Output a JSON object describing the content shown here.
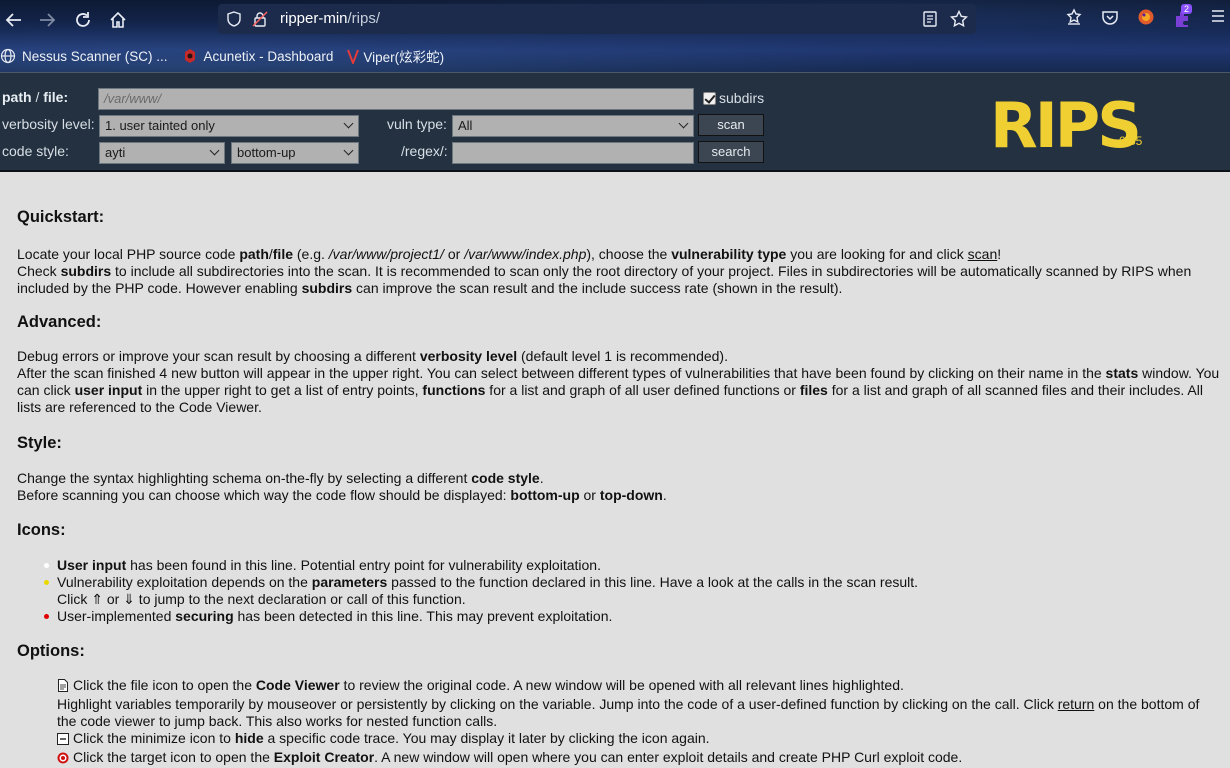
{
  "browser": {
    "url_host": "ripper-min",
    "url_path": "/rips/",
    "extension_badge": "2",
    "bookmarks": [
      {
        "label": "Nessus Scanner (SC) ...",
        "icon": "globe-icon"
      },
      {
        "label": "Acunetix - Dashboard",
        "icon": "acunetix-icon"
      },
      {
        "label": "Viper(炫彩蛇)",
        "icon": "viper-icon"
      }
    ]
  },
  "form": {
    "path_label": "path",
    "path_sep": " / ",
    "file_label": "file:",
    "path_placeholder": "/var/www/",
    "subdirs_label": "subdirs",
    "subdirs_checked": true,
    "verbosity_label": "verbosity level:",
    "verbosity_value": "1. user tainted only",
    "vuln_label": "vuln type:",
    "vuln_value": "All",
    "scan_button": "scan",
    "codestyle_label": "code style:",
    "codestyle_value": "ayti",
    "flow_value": "bottom-up",
    "regex_label": "/regex/:",
    "regex_value": "",
    "search_button": "search"
  },
  "logo": {
    "text": "RIPS",
    "version": "0.55",
    "color": "#f0cf32"
  },
  "content": {
    "quickstart": {
      "title": "Quickstart:",
      "l1_a": "Locate your local PHP source code ",
      "l1_b": "path",
      "l1_c": "/",
      "l1_d": "file",
      "l1_e": " (e.g. ",
      "l1_f": "/var/www/project1/",
      "l1_g": " or ",
      "l1_h": "/var/www/index.php",
      "l1_i": "), choose the ",
      "l1_j": "vulnerability type",
      "l1_k": " you are looking for and click ",
      "l1_link": "scan",
      "l1_l": "!",
      "l2_a": "Check ",
      "l2_b": "subdirs",
      "l2_c": " to include all subdirectories into the scan. It is recommended to scan only the root directory of your project. Files in subdirectories will be automatically scanned by RIPS when included by the PHP code. However enabling ",
      "l2_d": "subdirs",
      "l2_e": " can improve the scan result and the include success rate (shown in the result)."
    },
    "advanced": {
      "title": "Advanced:",
      "l1_a": "Debug errors or improve your scan result by choosing a different ",
      "l1_b": "verbosity level",
      "l1_c": " (default level 1 is recommended).",
      "l2_a": "After the scan finished 4 new button will appear in the upper right. You can select between different types of vulnerabilities that have been found by clicking on their name in the ",
      "l2_b": "stats",
      "l2_c": " window. You can click ",
      "l2_d": "user input",
      "l2_e": " in the upper right to get a list of entry points, ",
      "l2_f": "functions",
      "l2_g": " for a list and graph of all user defined functions or ",
      "l2_h": "files",
      "l2_i": " for a list and graph of all scanned files and their includes. All lists are referenced to the Code Viewer."
    },
    "style": {
      "title": "Style:",
      "l1_a": "Change the syntax highlighting schema on-the-fly by selecting a different ",
      "l1_b": "code style",
      "l1_c": ".",
      "l2_a": "Before scanning you can choose which way the code flow should be displayed: ",
      "l2_b": "bottom-up",
      "l2_c": " or ",
      "l2_d": "top-down",
      "l2_e": "."
    },
    "icons": {
      "title": "Icons:",
      "i1_a": "User input",
      "i1_b": " has been found in this line. Potential entry point for vulnerability exploitation.",
      "i2_a": "Vulnerability exploitation depends on the ",
      "i2_b": "parameters",
      "i2_c": " passed to the function declared in this line. Have a look at the calls in the scan result.",
      "i2_d": "Click ⇑ or ⇓ to jump to the next declaration or call of this function.",
      "i3_a": "User-implemented ",
      "i3_b": "securing",
      "i3_c": " has been detected in this line. This may prevent exploitation.",
      "dot_colors": [
        "#ffffff",
        "#e8d800",
        "#e00000"
      ]
    },
    "options": {
      "title": "Options:",
      "o1_a": "Click the file icon to open the ",
      "o1_b": "Code Viewer",
      "o1_c": " to review the original code. A new window will be opened with all relevant lines highlighted.",
      "o1_d": "Highlight variables temporarily by mouseover or persistently by clicking on the variable. Jump into the code of a user-defined function by clicking on the call. Click ",
      "o1_link": "return",
      "o1_e": " on the bottom of the code viewer to jump back. This also works for nested function calls.",
      "o2_a": "Click the minimize icon to ",
      "o2_b": "hide",
      "o2_c": " a specific code trace. You may display it later by clicking the icon again.",
      "o3_a": "Click the target icon to open the ",
      "o3_b": "Exploit Creator",
      "o3_c": ". A new window will open where you can enter exploit details and create PHP Curl exploit code."
    }
  }
}
